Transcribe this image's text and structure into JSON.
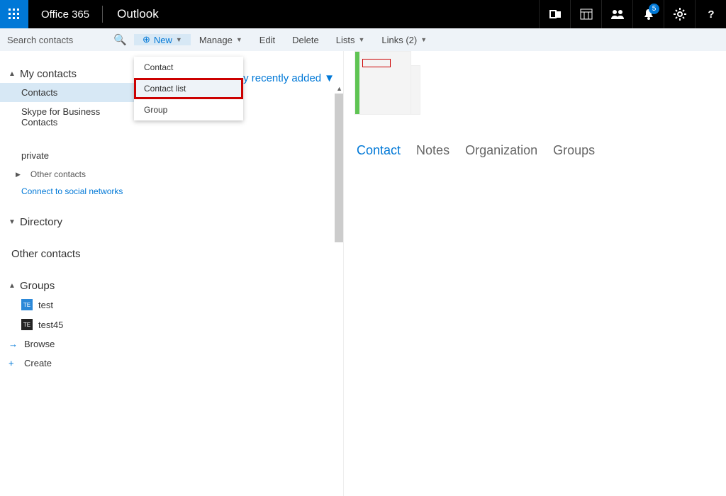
{
  "topbar": {
    "suite_label": "Office 365",
    "app_label": "Outlook",
    "notification_count": "5"
  },
  "sidebar": {
    "search_placeholder": "Search contacts",
    "my_contacts": {
      "header": "My contacts",
      "items": [
        {
          "label": "Contacts"
        },
        {
          "label": "Skype for Business Contacts"
        },
        {
          "label": "private"
        },
        {
          "label": "Other contacts"
        }
      ],
      "connect_label": "Connect to social networks"
    },
    "directory_header": "Directory",
    "other_contacts_header": "Other contacts",
    "groups": {
      "header": "Groups",
      "items": [
        {
          "tile": "TE",
          "label": "test"
        },
        {
          "tile": "TE",
          "label": "test45"
        }
      ],
      "browse_label": "Browse",
      "create_label": "Create"
    }
  },
  "toolbar": {
    "new_label": "New",
    "manage_label": "Manage",
    "edit_label": "Edit",
    "delete_label": "Delete",
    "lists_label": "Lists",
    "links_label": "Links (2)"
  },
  "new_menu": {
    "items": [
      {
        "label": "Contact"
      },
      {
        "label": "Contact list"
      },
      {
        "label": "Group"
      }
    ]
  },
  "list": {
    "sort_label": "By recently added"
  },
  "detail_tabs": {
    "contact": "Contact",
    "notes": "Notes",
    "organization": "Organization",
    "groups": "Groups"
  }
}
